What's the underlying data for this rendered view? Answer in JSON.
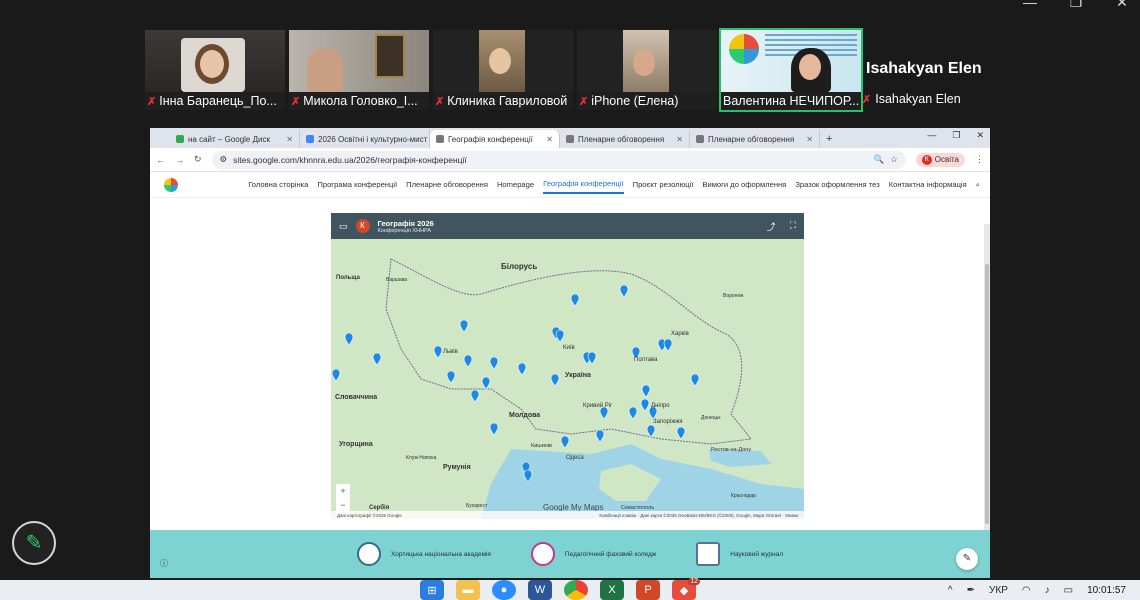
{
  "window_controls": [
    "—",
    "❐",
    "✕"
  ],
  "participants": [
    {
      "name": "Інна Баранець_По...",
      "muted": true
    },
    {
      "name": "Микола Головко_І...",
      "muted": true
    },
    {
      "name": "Клиника Гавриловой",
      "muted": true
    },
    {
      "name": "iPhone (Елена)",
      "muted": true
    },
    {
      "name": "Валентина НЕЧИПОР...",
      "muted": false,
      "active": true
    }
  ],
  "self": {
    "display_name": "Isahakyan Elen",
    "tile_name": "Isahakyan Elen"
  },
  "browser": {
    "tabs": [
      {
        "label": "на сайт – Google Диск",
        "selected": false
      },
      {
        "label": "2026 Освітні і культурно-мист",
        "selected": false
      },
      {
        "label": "Географія конференції",
        "selected": true
      },
      {
        "label": "Пленарне обговорення",
        "selected": false
      },
      {
        "label": "Пленарне обговорення",
        "selected": false
      }
    ],
    "new_tab": "+",
    "url": "sites.google.com/khnnra.edu.ua/2026/географія-конференції",
    "profile_label": "Освіта",
    "profile_initial": "К"
  },
  "site_nav": {
    "items": [
      {
        "label": "Головна сторінка",
        "selected": false
      },
      {
        "label": "Програма конференції",
        "selected": false
      },
      {
        "label": "Пленарне обговорення",
        "selected": false
      },
      {
        "label": "Homepage",
        "selected": false
      },
      {
        "label": "Географія конференції",
        "selected": true
      },
      {
        "label": "Проєкт резолюції",
        "selected": false
      },
      {
        "label": "Вимоги до оформлення",
        "selected": false
      },
      {
        "label": "Зразок оформлення тез",
        "selected": false
      },
      {
        "label": "Контактна інформація",
        "selected": false
      }
    ]
  },
  "map": {
    "title": "Географія 2026",
    "subtitle": "Конференція ХННРА",
    "avatar_initial": "К",
    "labels": {
      "belarus": "Білорусь",
      "poland": "Польща",
      "ukraine": "Україна",
      "moldova": "Молдова",
      "romania": "Румунія",
      "hungary": "Угорщина",
      "slovakia": "Словаччина",
      "serbia": "Сербія",
      "kyiv": "Київ",
      "lviv": "Львів",
      "kharkiv": "Харків",
      "poltava": "Полтава",
      "dnipro": "Дніпро",
      "odesa": "Одеса",
      "zaporizhzhia": "Запоріжжя",
      "kryvyi_rih": "Кривий Ріг",
      "chisinau": "Кишинів",
      "krasnodar": "Краснодар",
      "sevastopol": "Севастополь",
      "rostov": "Ростов-на-Дону",
      "voronezh": "Воронеж",
      "warsaw": "Варшава",
      "donetsk": "Донецьк",
      "bucharest": "Бухарест",
      "cluj": "Клуж-Напока"
    },
    "footer_left": "Дані картографії ©2026 Google",
    "footer_right": "Комбінації клавіш · Дані карти ©2026 GeoBasis-DE/BKG (©2009), Google, Mapa GISrael · Умови",
    "google": "Google My Maps"
  },
  "footer": {
    "items": [
      "Хортицька національна академія",
      "Педагогічний фаховий коледж",
      "Науковий журнал"
    ]
  },
  "taskbar": {
    "time": "10:01:57",
    "lang": "УКР",
    "badge": "12"
  }
}
